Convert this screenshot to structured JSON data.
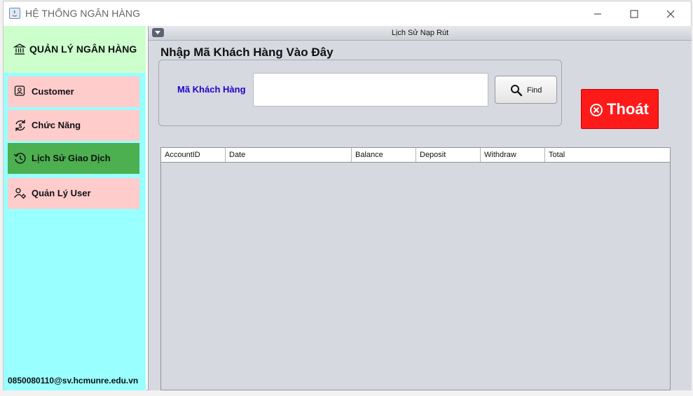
{
  "window": {
    "title": "HỆ THỐNG NGÂN HÀNG",
    "controls": {
      "minimize": "minimize-icon",
      "maximize": "maximize-icon",
      "close": "close-icon"
    }
  },
  "sidebar": {
    "brand": {
      "icon": "bank-icon",
      "label": "QUẢN LÝ NGÂN HÀNG"
    },
    "items": [
      {
        "icon": "user-badge-icon",
        "label": "Customer",
        "active": false
      },
      {
        "icon": "money-exchange-icon",
        "label": "Chức Năng",
        "active": false
      },
      {
        "icon": "history-icon",
        "label": "Lịch Sử Giao Dịch",
        "active": true
      },
      {
        "icon": "user-settings-icon",
        "label": "Quản Lý User",
        "active": false
      }
    ],
    "footer_email": "0850080110@sv.hcmunre.edu.vn"
  },
  "panel": {
    "header_title": "Lịch Sử Nạp Rút",
    "section_title": "Nhập Mã Khách Hàng Vào Đây",
    "search": {
      "label": "Mã Khách Hàng",
      "value": "",
      "placeholder": "",
      "button_label": "Find",
      "button_icon": "search-icon"
    },
    "exit_button": {
      "label": "Thoát",
      "icon": "close-circle-icon"
    },
    "table": {
      "columns": [
        "AccountID",
        "Date",
        "Balance",
        "Deposit",
        "Withdraw",
        "Total"
      ],
      "rows": []
    }
  },
  "colors": {
    "sidebar_bg": "#99ffff",
    "brand_bg": "#ccffcc",
    "nav_item_bg": "#ffcccc",
    "nav_active_bg": "#4caf50",
    "exit_button_bg": "#ff1a1a",
    "search_label": "#2200cc"
  }
}
